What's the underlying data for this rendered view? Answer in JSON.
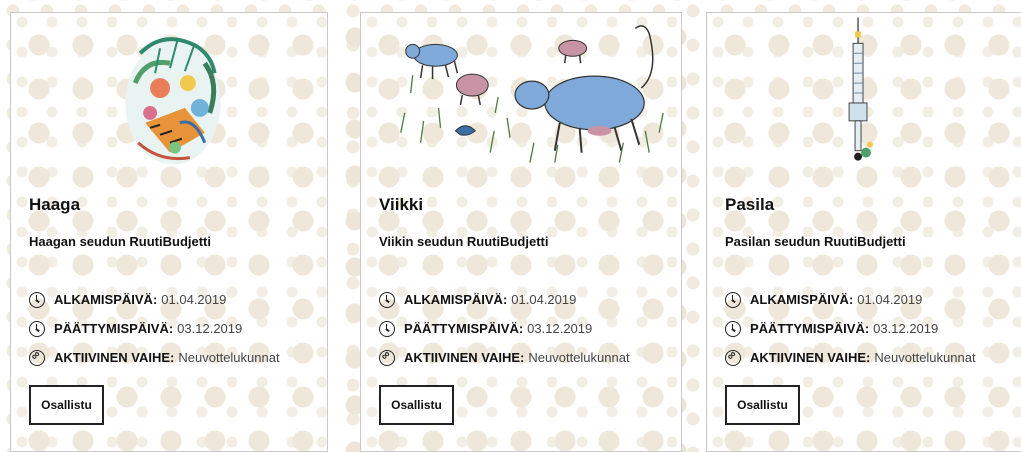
{
  "labels": {
    "start": "ALKAMISPÄIVÄ:",
    "end": "PÄÄTTYMISPÄIVÄ:",
    "phase": "AKTIIVINEN VAIHE:"
  },
  "cards": [
    {
      "title": "Haaga",
      "subtitle": "Haagan seudun RuutiBudjetti",
      "start_date": "01.04.2019",
      "end_date": "03.12.2019",
      "phase": "Neuvottelukunnat",
      "button_label": "Osallistu",
      "illustration": "jungle-tiger-illustration"
    },
    {
      "title": "Viikki",
      "subtitle": "Viikin seudun RuutiBudjetti",
      "start_date": "01.04.2019",
      "end_date": "03.12.2019",
      "phase": "Neuvottelukunnat",
      "button_label": "Osallistu",
      "illustration": "cows-field-illustration"
    },
    {
      "title": "Pasila",
      "subtitle": "Pasilan seudun RuutiBudjetti",
      "start_date": "01.04.2019",
      "end_date": "03.12.2019",
      "phase": "Neuvottelukunnat",
      "button_label": "Osallistu",
      "illustration": "tv-tower-illustration"
    }
  ],
  "colors": {
    "dots": "#ede6d8",
    "card_border": "#c9c9c9",
    "text": "#111111",
    "cow_blue": "#7fa9d9",
    "cow_pink": "#c993a6"
  }
}
